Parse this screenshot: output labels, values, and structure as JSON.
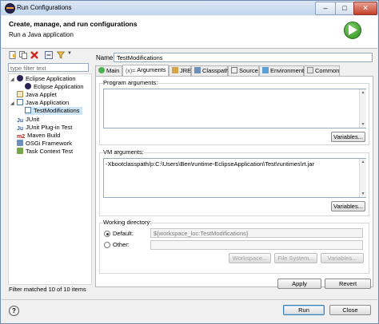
{
  "window": {
    "title": "Run Configurations",
    "buttons": {
      "minimize": "–",
      "maximize": "□",
      "close": "✕"
    }
  },
  "header": {
    "title": "Create, manage, and run configurations",
    "subtitle": "Run a Java application"
  },
  "left": {
    "filter_placeholder": "type filter text",
    "tree": [
      {
        "label": "Eclipse Application",
        "level": 0,
        "expanded": true,
        "icon": "eclipse-icon"
      },
      {
        "label": "Eclipse Application",
        "level": 1,
        "icon": "eclipse-icon"
      },
      {
        "label": "Java Applet",
        "level": 0,
        "icon": "java-applet-icon"
      },
      {
        "label": "Java Application",
        "level": 0,
        "expanded": true,
        "icon": "java-app-icon"
      },
      {
        "label": "TestModifications",
        "level": 1,
        "selected": true,
        "icon": "java-class-icon"
      },
      {
        "label": "JUnit",
        "level": 0,
        "icon": "junit-icon"
      },
      {
        "label": "JUnit Plug-in Test",
        "level": 0,
        "icon": "junit-plugin-icon"
      },
      {
        "label": "Maven Build",
        "level": 0,
        "icon": "maven-icon"
      },
      {
        "label": "OSGi Framework",
        "level": 0,
        "icon": "osgi-icon"
      },
      {
        "label": "Task Context Test",
        "level": 0,
        "icon": "task-icon"
      }
    ],
    "status": "Filter matched 10 of 10 items"
  },
  "right": {
    "name_label": "Name:",
    "name_value": "TestModifications",
    "tabs": [
      {
        "label": "Main",
        "icon": "main-tab-icon"
      },
      {
        "label": "Arguments",
        "icon": "arguments-tab-icon",
        "active": true
      },
      {
        "label": "JRE",
        "icon": "jre-tab-icon"
      },
      {
        "label": "Classpath",
        "icon": "classpath-tab-icon"
      },
      {
        "label": "Source",
        "icon": "source-tab-icon"
      },
      {
        "label": "Environment",
        "icon": "environment-tab-icon"
      },
      {
        "label": "Common",
        "icon": "common-tab-icon"
      }
    ],
    "program_args_label": "Program arguments:",
    "program_args_value": "",
    "variables_label": "Variables...",
    "vm_args_label": "VM arguments:",
    "vm_args_value": "-Xbootclasspath/p:C:\\Users\\Ben\\runtime-EclipseApplication\\Test\\runtimes\\rt.jar",
    "working_dir_label": "Working directory:",
    "default_label": "Default:",
    "default_value": "${workspace_loc:TestModifications}",
    "other_label": "Other:",
    "workspace_btn": "Workspace...",
    "filesystem_btn": "File System...",
    "wd_variables_btn": "Variables...",
    "apply": "Apply",
    "revert": "Revert"
  },
  "footer": {
    "help": "?",
    "run": "Run",
    "close": "Close"
  }
}
